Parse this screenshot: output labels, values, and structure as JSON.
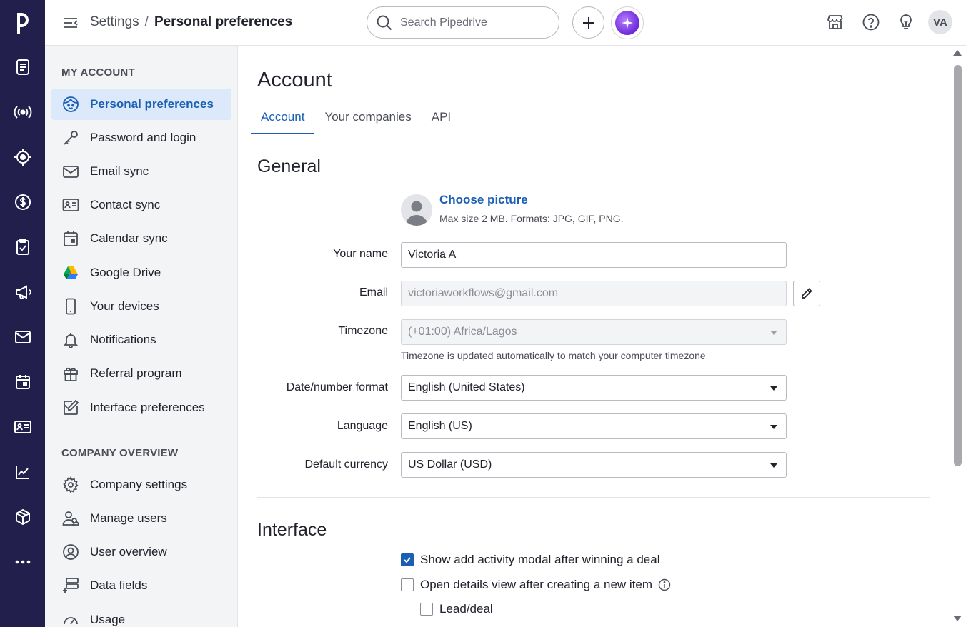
{
  "app": {
    "logo_letter": "p"
  },
  "rail": {
    "items": [
      {
        "icon": "leads-inbox-icon"
      },
      {
        "icon": "campaigns-broadcast-icon"
      },
      {
        "icon": "target-icon"
      },
      {
        "icon": "deals-dollar-icon"
      },
      {
        "icon": "activities-clipboard-icon"
      },
      {
        "icon": "megaphone-icon"
      },
      {
        "icon": "mail-icon"
      },
      {
        "icon": "calendar-icon"
      },
      {
        "icon": "contacts-card-icon"
      },
      {
        "icon": "insights-chart-icon"
      },
      {
        "icon": "products-box-icon"
      },
      {
        "icon": "more-icon"
      }
    ]
  },
  "header": {
    "breadcrumb_parent": "Settings",
    "breadcrumb_sep": "/",
    "breadcrumb_current": "Personal preferences",
    "search_placeholder": "Search Pipedrive",
    "avatar_initials": "VA"
  },
  "sidebar": {
    "my_account_heading": "MY ACCOUNT",
    "company_heading": "COMPANY OVERVIEW",
    "my_account": [
      {
        "label": "Personal preferences",
        "icon": "face-icon",
        "active": true
      },
      {
        "label": "Password and login",
        "icon": "key-icon"
      },
      {
        "label": "Email sync",
        "icon": "envelope-icon"
      },
      {
        "label": "Contact sync",
        "icon": "contact-card-icon"
      },
      {
        "label": "Calendar sync",
        "icon": "calendar-icon"
      },
      {
        "label": "Google Drive",
        "icon": "google-drive-icon"
      },
      {
        "label": "Your devices",
        "icon": "phone-icon"
      },
      {
        "label": "Notifications",
        "icon": "bell-icon"
      },
      {
        "label": "Referral program",
        "icon": "gift-icon"
      },
      {
        "label": "Interface preferences",
        "icon": "edit-window-icon"
      }
    ],
    "company": [
      {
        "label": "Company settings",
        "icon": "gear-icon"
      },
      {
        "label": "Manage users",
        "icon": "users-icon"
      },
      {
        "label": "User overview",
        "icon": "user-circle-icon"
      },
      {
        "label": "Data fields",
        "icon": "data-fields-icon"
      },
      {
        "label": "Usage",
        "icon": "gauge-icon"
      }
    ]
  },
  "main": {
    "title": "Account",
    "tabs": [
      {
        "label": "Account",
        "active": true
      },
      {
        "label": "Your companies"
      },
      {
        "label": "API"
      }
    ],
    "general_title": "General",
    "choose_picture": "Choose picture",
    "picture_hint": "Max size 2 MB. Formats: JPG, GIF, PNG.",
    "fields": {
      "name_label": "Your name",
      "name_value": "Victoria A",
      "email_label": "Email",
      "email_value": "victoriaworkflows@gmail.com",
      "timezone_label": "Timezone",
      "timezone_value": "(+01:00) Africa/Lagos",
      "timezone_hint": "Timezone is updated automatically to match your computer timezone",
      "date_label": "Date/number format",
      "date_value": "English (United States)",
      "language_label": "Language",
      "language_value": "English (US)",
      "currency_label": "Default currency",
      "currency_value": "US Dollar (USD)"
    },
    "interface_title": "Interface",
    "checkboxes": [
      {
        "label": "Show add activity modal after winning a deal",
        "checked": true
      },
      {
        "label": "Open details view after creating a new item",
        "checked": false
      },
      {
        "label": "Lead/deal",
        "checked": false
      }
    ]
  },
  "colors": {
    "rail_bg": "#231f4d",
    "accent": "#1a5fb4",
    "active_bg": "#dbe9fb"
  }
}
